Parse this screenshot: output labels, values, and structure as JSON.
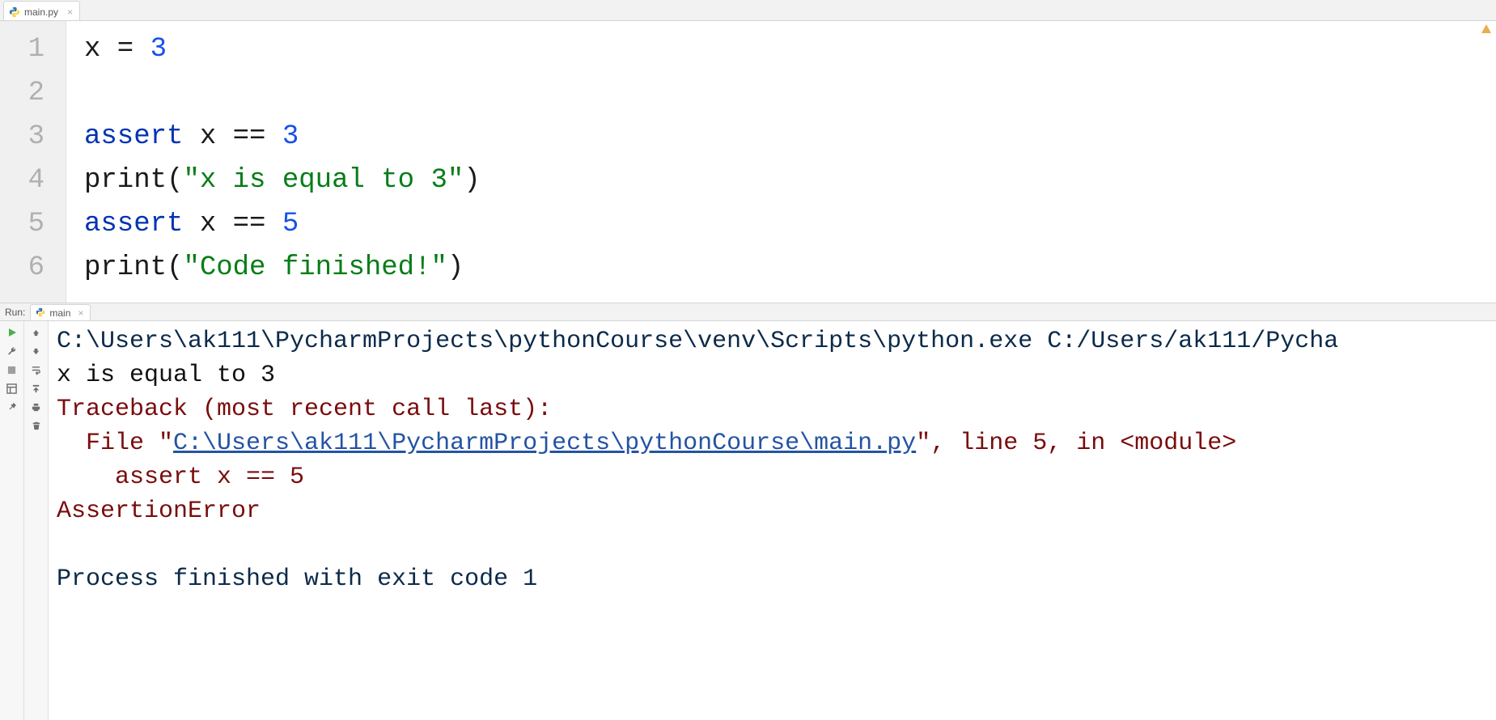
{
  "tabs": {
    "file_name": "main.py"
  },
  "editor": {
    "lines": {
      "n1": "1",
      "n2": "2",
      "n3": "3",
      "n4": "4",
      "n5": "5",
      "n6": "6"
    },
    "l1": {
      "var": "x",
      "eq": " = ",
      "val": "3"
    },
    "l2": "",
    "l3": {
      "kw": "assert",
      "sp": " ",
      "var": "x",
      "op": " == ",
      "val": "3"
    },
    "l4": {
      "fn": "print",
      "lp": "(",
      "str": "\"x is equal to 3\"",
      "rp": ")"
    },
    "l5": {
      "kw": "assert",
      "sp": " ",
      "var": "x",
      "op": " == ",
      "val": "5"
    },
    "l6": {
      "fn": "print",
      "lp": "(",
      "str": "\"Code finished!\"",
      "rp": ")"
    }
  },
  "run": {
    "label": "Run:",
    "tab_name": "main"
  },
  "console": {
    "cmd": "C:\\Users\\ak111\\PycharmProjects\\pythonCourse\\venv\\Scripts\\python.exe C:/Users/ak111/Pycha",
    "out1": "x is equal to 3",
    "tb_header": "Traceback (most recent call last):",
    "tb_file_pre": "  File \"",
    "tb_file_link": "C:\\Users\\ak111\\PycharmProjects\\pythonCourse\\main.py",
    "tb_file_post": "\", line 5, in <module>",
    "tb_code": "    assert x == 5",
    "tb_err": "AssertionError",
    "blank": "",
    "exit": "Process finished with exit code 1"
  }
}
